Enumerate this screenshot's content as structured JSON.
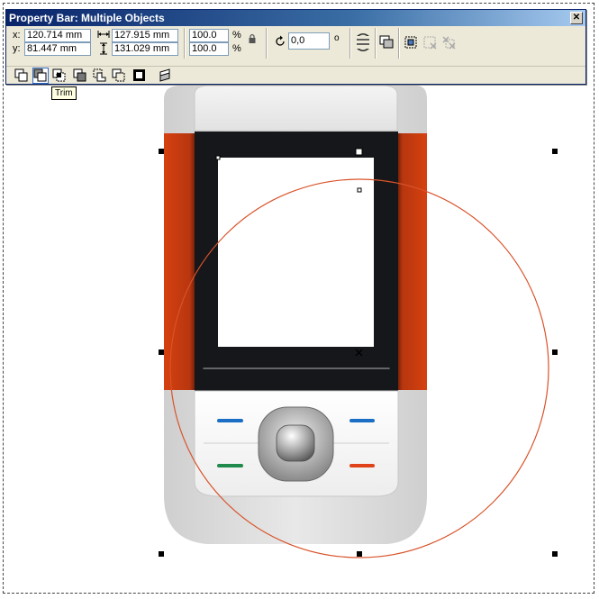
{
  "window": {
    "title": "Property Bar: Multiple Objects"
  },
  "position": {
    "x_label": "x:",
    "x_value": "120.714 mm",
    "y_label": "y:",
    "y_value": "81.447 mm"
  },
  "size": {
    "width_value": "127.915 mm",
    "height_value": "131.029 mm"
  },
  "scale": {
    "x_value": "100.0",
    "y_value": "100.0",
    "x_unit": "%",
    "y_unit": "%"
  },
  "rotation": {
    "value": "0,0",
    "unit": "o"
  },
  "shaping_tools": {
    "items": [
      "weld",
      "trim",
      "intersect",
      "simplify",
      "front-minus-back",
      "back-minus-front",
      "create-boundary",
      "align-distribute"
    ],
    "selected": "trim"
  },
  "tooltip": {
    "text": "Trim"
  },
  "colors": {
    "title_bar": "#0a246a",
    "panel": "#ece9d8",
    "phone_orange": "#c93a12",
    "screen_bezel": "#16171a",
    "circle_outline": "#d9532a",
    "key_blue": "#1a6fc4",
    "key_green": "#1f8a4c",
    "key_red": "#e0421a"
  }
}
